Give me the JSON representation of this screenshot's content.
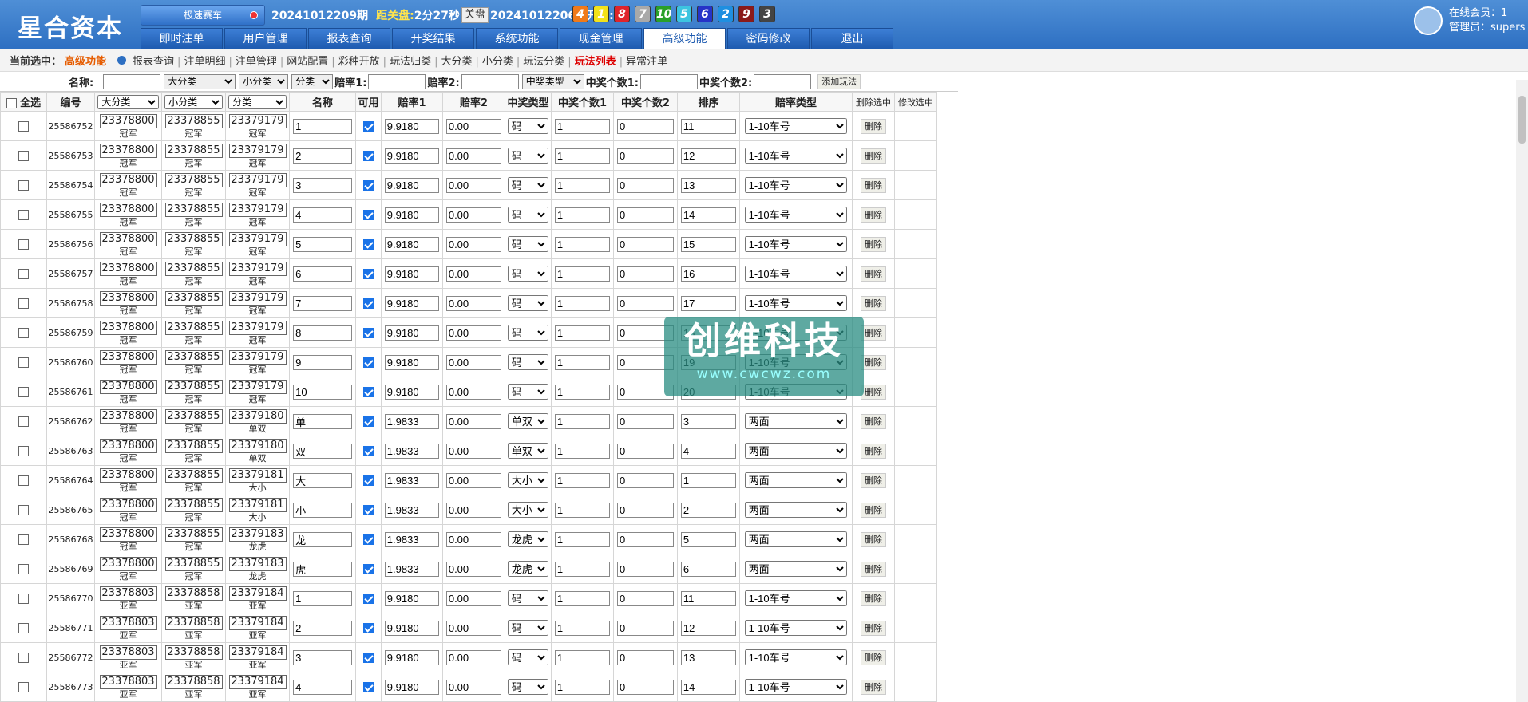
{
  "header": {
    "logo": "星合资本",
    "game_button": "极速赛车",
    "current_period": "20241012209期",
    "countdown_label": "距关盘:",
    "countdown": "2分27秒",
    "close_btn": "关盘",
    "last_period": "20241012206期开奖:",
    "balls": [
      {
        "n": "4",
        "color": "#f07a1a"
      },
      {
        "n": "1",
        "color": "#f2e21a"
      },
      {
        "n": "8",
        "color": "#e0242a"
      },
      {
        "n": "7",
        "color": "#a9a9a9"
      },
      {
        "n": "10",
        "color": "#2aa02a"
      },
      {
        "n": "5",
        "color": "#3cc4e0"
      },
      {
        "n": "6",
        "color": "#2633c8"
      },
      {
        "n": "2",
        "color": "#1f8fe0"
      },
      {
        "n": "9",
        "color": "#8b1a1a"
      },
      {
        "n": "3",
        "color": "#444444"
      }
    ]
  },
  "nav": [
    "即时注单",
    "用户管理",
    "报表查询",
    "开奖结果",
    "系统功能",
    "现金管理",
    "高级功能",
    "密码修改",
    "退出"
  ],
  "user": {
    "online": "在线会员：1",
    "admin": "管理员：supers"
  },
  "subbar": {
    "label": "当前选中：",
    "current": "高级功能",
    "links": [
      "报表查询",
      "注单明细",
      "注单管理",
      "网站配置",
      "彩种开放",
      "玩法归类",
      "大分类",
      "小分类",
      "玩法分类",
      "玩法列表",
      "异常注单"
    ]
  },
  "filter": {
    "name": "名称:",
    "big": "大分类",
    "small": "小分类",
    "cls": "分类",
    "rate1": "赔率1:",
    "rate2": "赔率2:",
    "wintype": "中奖类型",
    "win1": "中奖个数1:",
    "win2": "中奖个数2:",
    "add": "添加玩法"
  },
  "table": {
    "headers": [
      "全选",
      "编号",
      "大分类",
      "小分类",
      "分类",
      "名称",
      "可用",
      "赔率1",
      "赔率2",
      "中奖类型",
      "中奖个数1",
      "中奖个数2",
      "排序",
      "赔率类型",
      "删除选中",
      "修改选中"
    ],
    "del": "删除",
    "rows": [
      [
        "25586752",
        "23378800",
        "冠军",
        "23378855",
        "冠军",
        "23379179",
        "冠军",
        "1",
        "9.9180",
        "0.00",
        "码",
        "1",
        "0",
        "11",
        "1-10车号"
      ],
      [
        "25586753",
        "23378800",
        "冠军",
        "23378855",
        "冠军",
        "23379179",
        "冠军",
        "2",
        "9.9180",
        "0.00",
        "码",
        "1",
        "0",
        "12",
        "1-10车号"
      ],
      [
        "25586754",
        "23378800",
        "冠军",
        "23378855",
        "冠军",
        "23379179",
        "冠军",
        "3",
        "9.9180",
        "0.00",
        "码",
        "1",
        "0",
        "13",
        "1-10车号"
      ],
      [
        "25586755",
        "23378800",
        "冠军",
        "23378855",
        "冠军",
        "23379179",
        "冠军",
        "4",
        "9.9180",
        "0.00",
        "码",
        "1",
        "0",
        "14",
        "1-10车号"
      ],
      [
        "25586756",
        "23378800",
        "冠军",
        "23378855",
        "冠军",
        "23379179",
        "冠军",
        "5",
        "9.9180",
        "0.00",
        "码",
        "1",
        "0",
        "15",
        "1-10车号"
      ],
      [
        "25586757",
        "23378800",
        "冠军",
        "23378855",
        "冠军",
        "23379179",
        "冠军",
        "6",
        "9.9180",
        "0.00",
        "码",
        "1",
        "0",
        "16",
        "1-10车号"
      ],
      [
        "25586758",
        "23378800",
        "冠军",
        "23378855",
        "冠军",
        "23379179",
        "冠军",
        "7",
        "9.9180",
        "0.00",
        "码",
        "1",
        "0",
        "17",
        "1-10车号"
      ],
      [
        "25586759",
        "23378800",
        "冠军",
        "23378855",
        "冠军",
        "23379179",
        "冠军",
        "8",
        "9.9180",
        "0.00",
        "码",
        "1",
        "0",
        "18",
        "1-10车号"
      ],
      [
        "25586760",
        "23378800",
        "冠军",
        "23378855",
        "冠军",
        "23379179",
        "冠军",
        "9",
        "9.9180",
        "0.00",
        "码",
        "1",
        "0",
        "19",
        "1-10车号"
      ],
      [
        "25586761",
        "23378800",
        "冠军",
        "23378855",
        "冠军",
        "23379179",
        "冠军",
        "10",
        "9.9180",
        "0.00",
        "码",
        "1",
        "0",
        "20",
        "1-10车号"
      ],
      [
        "25586762",
        "23378800",
        "冠军",
        "23378855",
        "冠军",
        "23379180",
        "单双",
        "单",
        "1.9833",
        "0.00",
        "单双",
        "1",
        "0",
        "3",
        "两面"
      ],
      [
        "25586763",
        "23378800",
        "冠军",
        "23378855",
        "冠军",
        "23379180",
        "单双",
        "双",
        "1.9833",
        "0.00",
        "单双",
        "1",
        "0",
        "4",
        "两面"
      ],
      [
        "25586764",
        "23378800",
        "冠军",
        "23378855",
        "冠军",
        "23379181",
        "大小",
        "大",
        "1.9833",
        "0.00",
        "大小",
        "1",
        "0",
        "1",
        "两面"
      ],
      [
        "25586765",
        "23378800",
        "冠军",
        "23378855",
        "冠军",
        "23379181",
        "大小",
        "小",
        "1.9833",
        "0.00",
        "大小",
        "1",
        "0",
        "2",
        "两面"
      ],
      [
        "25586768",
        "23378800",
        "冠军",
        "23378855",
        "冠军",
        "23379183",
        "龙虎",
        "龙",
        "1.9833",
        "0.00",
        "龙虎",
        "1",
        "0",
        "5",
        "两面"
      ],
      [
        "25586769",
        "23378800",
        "冠军",
        "23378855",
        "冠军",
        "23379183",
        "龙虎",
        "虎",
        "1.9833",
        "0.00",
        "龙虎",
        "1",
        "0",
        "6",
        "两面"
      ],
      [
        "25586770",
        "23378803",
        "亚军",
        "23378858",
        "亚军",
        "23379184",
        "亚军",
        "1",
        "9.9180",
        "0.00",
        "码",
        "1",
        "0",
        "11",
        "1-10车号"
      ],
      [
        "25586771",
        "23378803",
        "亚军",
        "23378858",
        "亚军",
        "23379184",
        "亚军",
        "2",
        "9.9180",
        "0.00",
        "码",
        "1",
        "0",
        "12",
        "1-10车号"
      ],
      [
        "25586772",
        "23378803",
        "亚军",
        "23378858",
        "亚军",
        "23379184",
        "亚军",
        "3",
        "9.9180",
        "0.00",
        "码",
        "1",
        "0",
        "13",
        "1-10车号"
      ],
      [
        "25586773",
        "23378803",
        "亚军",
        "23378858",
        "亚军",
        "23379184",
        "亚军",
        "4",
        "9.9180",
        "0.00",
        "码",
        "1",
        "0",
        "14",
        "1-10车号"
      ]
    ]
  },
  "watermark": {
    "title": "创维科技",
    "url": "www.cwcwz.com"
  }
}
